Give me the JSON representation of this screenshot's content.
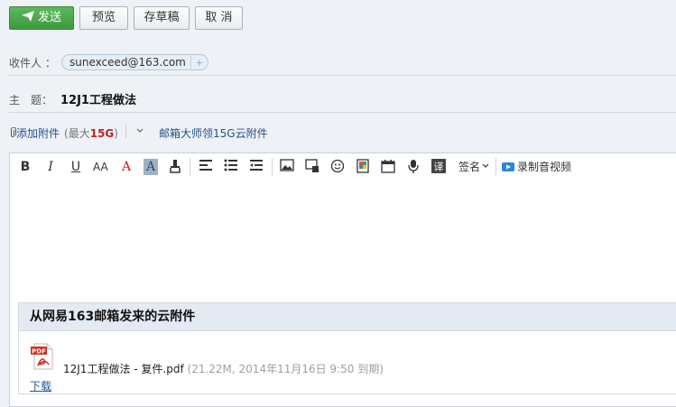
{
  "toolbar": {
    "send_label": "发送",
    "preview_label": "预览",
    "draft_label": "存草稿",
    "cancel_label": "取 消"
  },
  "recipients": {
    "label": "收件人 ：",
    "items": [
      "sunexceed@163.com"
    ],
    "add": "+"
  },
  "subject": {
    "label": "主　题：",
    "value": "12J1工程做法"
  },
  "attachments": {
    "add_label": "添加附件",
    "max_prefix": "(最大",
    "max_value": "15G",
    "max_suffix": ")",
    "cloud_link": "邮箱大师领15G云附件"
  },
  "editor_toolbar": {
    "bold": "B",
    "italic": "I",
    "underline": "U",
    "font_size": "AA",
    "font_color": "A",
    "bg_color": "A",
    "signature_label": "签名",
    "video_label": "录制音视频"
  },
  "cloud_attachment": {
    "title": "从网易163邮箱发来的云附件",
    "file_name": "12J1工程做法 - 复件.pdf",
    "file_meta": "(21.22M, 2014年11月16日 9:50 到期)",
    "download": "下载",
    "pdf_label": "PDF"
  },
  "colors": {
    "send_green": "#4aa84a",
    "link_blue": "#25508c",
    "max_red": "#c81e1e"
  }
}
